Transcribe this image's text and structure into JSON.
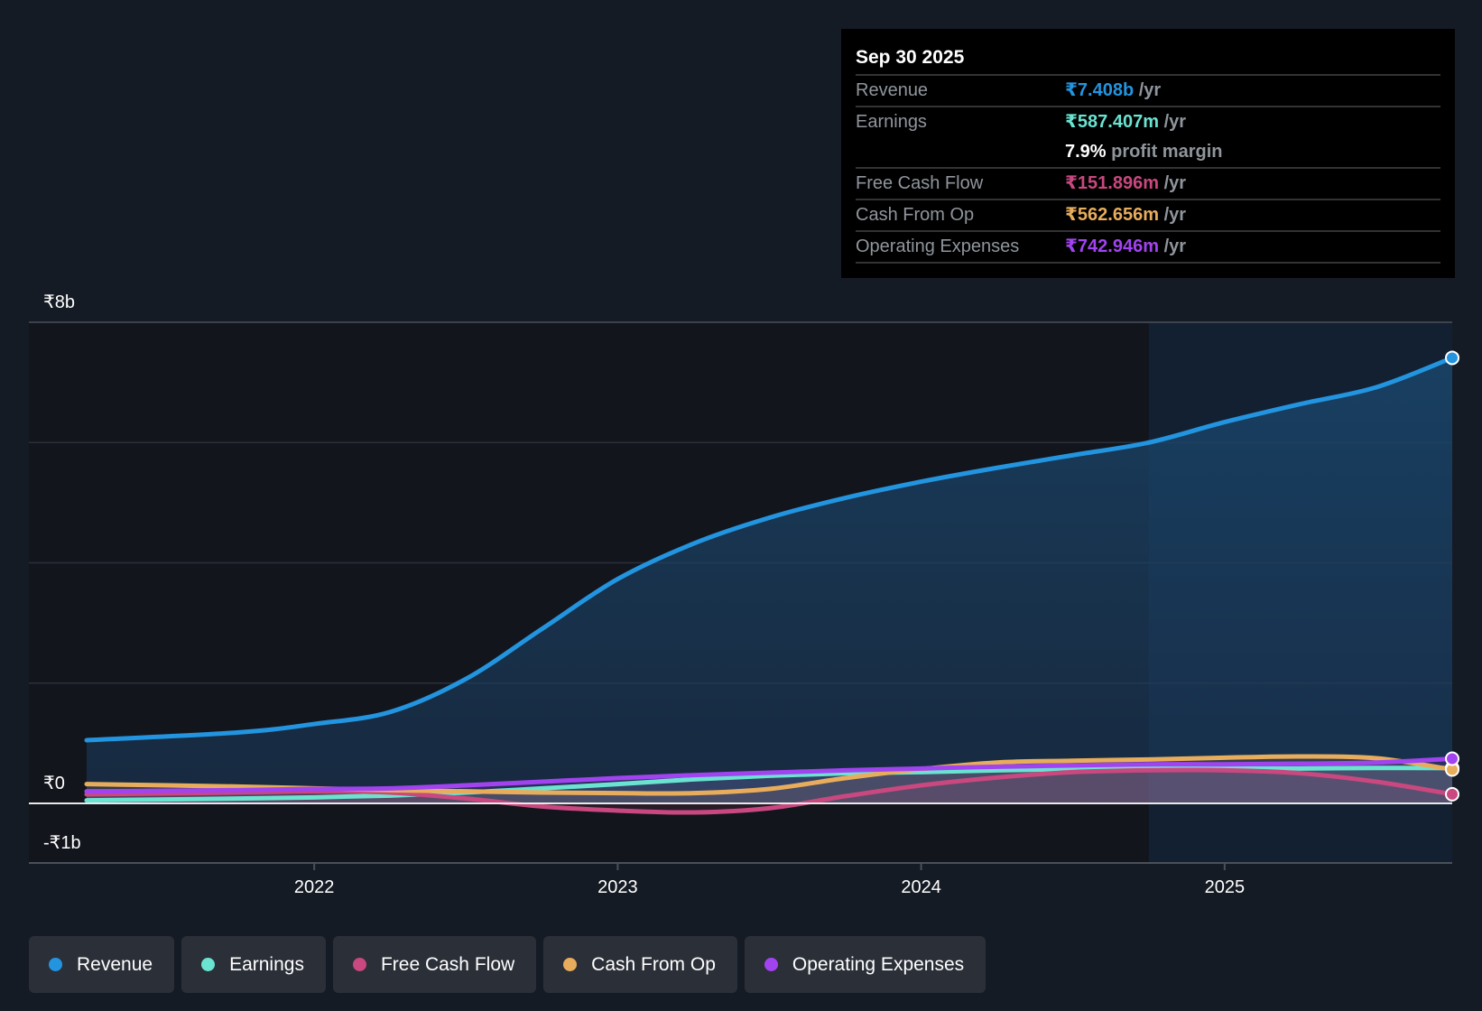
{
  "tooltip": {
    "date": "Sep 30 2025",
    "rows": [
      {
        "label": "Revenue",
        "value": "₹7.408b",
        "unit": "/yr",
        "color": "#2394df"
      },
      {
        "label": "Earnings",
        "value": "₹587.407m",
        "unit": "/yr",
        "color": "#6ae3d1",
        "extra_value": "7.9%",
        "extra_text": "profit margin"
      },
      {
        "label": "Free Cash Flow",
        "value": "₹151.896m",
        "unit": "/yr",
        "color": "#c8487f"
      },
      {
        "label": "Cash From Op",
        "value": "₹562.656m",
        "unit": "/yr",
        "color": "#e8ad5c"
      },
      {
        "label": "Operating Expenses",
        "value": "₹742.946m",
        "unit": "/yr",
        "color": "#a144f0"
      }
    ]
  },
  "legend": [
    {
      "label": "Revenue",
      "color": "#2394df"
    },
    {
      "label": "Earnings",
      "color": "#6ae3d1"
    },
    {
      "label": "Free Cash Flow",
      "color": "#c8487f"
    },
    {
      "label": "Cash From Op",
      "color": "#e8ad5c"
    },
    {
      "label": "Operating Expenses",
      "color": "#a144f0"
    }
  ],
  "chart_data": {
    "type": "line",
    "title": "",
    "xlabel": "",
    "ylabel": "",
    "unit": "₹ billions",
    "xlim": [
      2021.24,
      2025.75
    ],
    "ylim": [
      -1,
      8
    ],
    "y_tick_labels": [
      {
        "value": 8,
        "label": "₹8b"
      },
      {
        "value": 0,
        "label": "₹0"
      },
      {
        "value": -1,
        "label": "-₹1b"
      }
    ],
    "gridlines": [
      8,
      6,
      4,
      2
    ],
    "x_ticks": [
      {
        "value": 2022,
        "label": "2022"
      },
      {
        "value": 2023,
        "label": "2023"
      },
      {
        "value": 2024,
        "label": "2024"
      },
      {
        "value": 2025,
        "label": "2025"
      }
    ],
    "highlight_from": 2024.75,
    "x": [
      2021.25,
      2021.75,
      2022.0,
      2022.25,
      2022.5,
      2022.75,
      2023.0,
      2023.25,
      2023.5,
      2023.75,
      2024.0,
      2024.25,
      2024.5,
      2024.75,
      2025.0,
      2025.25,
      2025.5,
      2025.75
    ],
    "series": [
      {
        "name": "Revenue",
        "color": "#2394df",
        "values": [
          1.05,
          1.18,
          1.32,
          1.52,
          2.07,
          2.9,
          3.73,
          4.32,
          4.75,
          5.08,
          5.35,
          5.58,
          5.79,
          6.0,
          6.34,
          6.64,
          6.92,
          7.408
        ]
      },
      {
        "name": "Earnings",
        "color": "#6ae3d1",
        "values": [
          0.05,
          0.08,
          0.1,
          0.13,
          0.18,
          0.25,
          0.32,
          0.4,
          0.46,
          0.5,
          0.52,
          0.55,
          0.57,
          0.58,
          0.58,
          0.58,
          0.59,
          0.587
        ]
      },
      {
        "name": "Free Cash Flow",
        "color": "#c8487f",
        "values": [
          0.15,
          0.18,
          0.2,
          0.18,
          0.08,
          -0.05,
          -0.12,
          -0.15,
          -0.08,
          0.12,
          0.3,
          0.43,
          0.52,
          0.55,
          0.55,
          0.5,
          0.36,
          0.152
        ]
      },
      {
        "name": "Cash From Op",
        "color": "#e8ad5c",
        "values": [
          0.32,
          0.28,
          0.25,
          0.22,
          0.2,
          0.18,
          0.17,
          0.17,
          0.24,
          0.42,
          0.57,
          0.68,
          0.71,
          0.73,
          0.76,
          0.78,
          0.75,
          0.563
        ]
      },
      {
        "name": "Operating Expenses",
        "color": "#a144f0",
        "values": [
          0.2,
          0.22,
          0.24,
          0.25,
          0.3,
          0.36,
          0.42,
          0.47,
          0.51,
          0.55,
          0.58,
          0.61,
          0.63,
          0.65,
          0.65,
          0.66,
          0.68,
          0.743
        ]
      }
    ]
  }
}
